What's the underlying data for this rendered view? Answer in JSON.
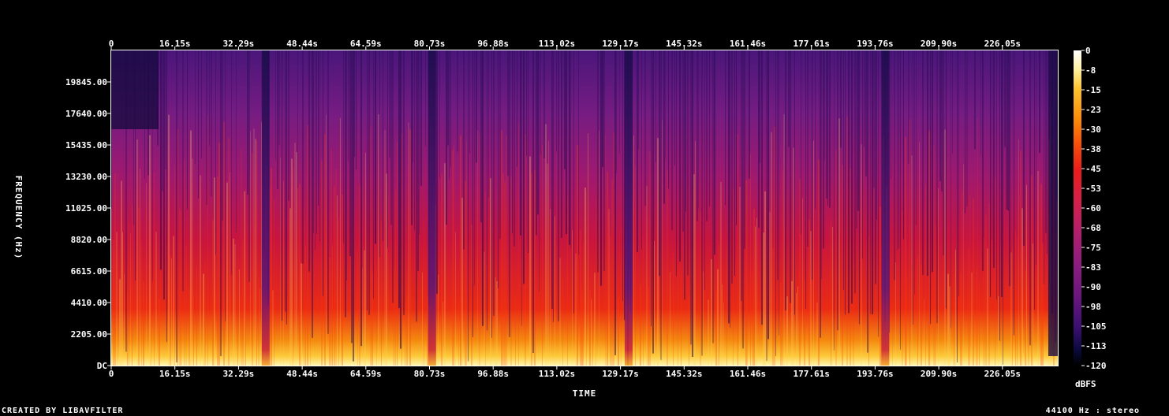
{
  "chart_data": {
    "type": "heatmap",
    "title": "",
    "xlabel": "TIME",
    "ylabel": "FREQUENCY (Hz)",
    "x_unit": "s",
    "x_ticks_top": [
      "0",
      "16.15s",
      "32.29s",
      "48.44s",
      "64.59s",
      "80.73s",
      "96.88s",
      "113.02s",
      "129.17s",
      "145.32s",
      "161.46s",
      "177.61s",
      "193.76s",
      "209.90s",
      "226.05s"
    ],
    "x_ticks_bottom": [
      "0",
      "16.15s",
      "32.29s",
      "48.44s",
      "64.59s",
      "80.73s",
      "96.88s",
      "113.02s",
      "129.17s",
      "145.32s",
      "161.46s",
      "177.61s",
      "193.76s",
      "209.90s",
      "226.05s"
    ],
    "y_ticks": [
      "DC",
      "2205.00",
      "4410.00",
      "6615.00",
      "8820.00",
      "11025.00",
      "13230.00",
      "15435.00",
      "17640.00",
      "19845.00"
    ],
    "y_range": [
      0,
      22050
    ],
    "x_range": [
      0,
      236
    ],
    "colorbar": {
      "label": "dBFS",
      "ticks": [
        "0",
        "-8",
        "-15",
        "-23",
        "-30",
        "-38",
        "-45",
        "-53",
        "-60",
        "-68",
        "-75",
        "-83",
        "-90",
        "-98",
        "-105",
        "-113",
        "-120"
      ],
      "range": [
        -120,
        0
      ],
      "colors": [
        "#000000",
        "#0b0a3d",
        "#3b0f70",
        "#6a177e",
        "#8c1d7f",
        "#b01f6f",
        "#d4204b",
        "#ec1c1c",
        "#f64d0a",
        "#fb8a09",
        "#fdc330",
        "#fff2a0",
        "#ffffff"
      ]
    },
    "quiet_segments_s": [
      38.5,
      80.0,
      129.0,
      193.0
    ],
    "loud_region": "low frequencies (below ~2 kHz) bright yellow throughout"
  },
  "footer": {
    "left": "CREATED BY LIBAVFILTER",
    "right": "44100 Hz : stereo"
  }
}
